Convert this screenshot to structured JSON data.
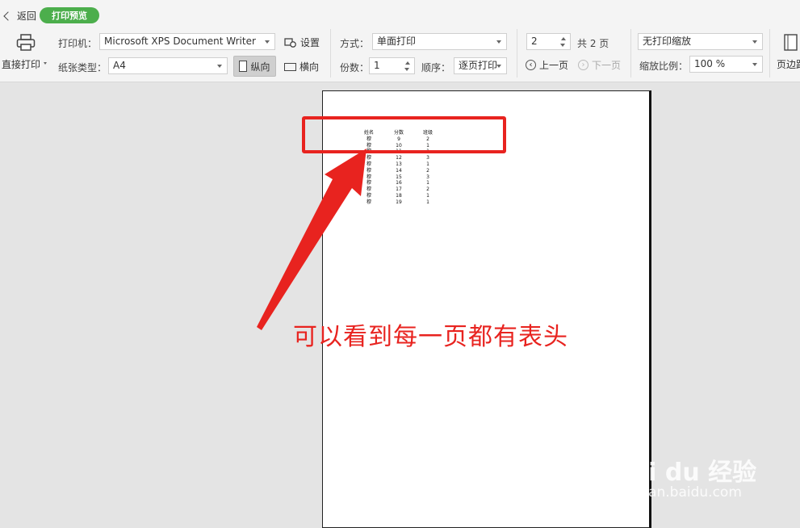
{
  "header": {
    "back_label": "返回",
    "mode_badge": "打印预览"
  },
  "toolbar": {
    "direct_print": "直接打印",
    "printer_label": "打印机：",
    "printer_value": "Microsoft XPS Document Writer",
    "settings": "设置",
    "paper_label": "纸张类型：",
    "paper_value": "A4",
    "portrait": "纵向",
    "landscape": "横向",
    "mode_label": "方式：",
    "mode_value": "单面打印",
    "copies_label": "份数：",
    "copies_value": "1",
    "order_label": "顺序：",
    "order_value": "逐页打印",
    "page_value": "2",
    "total_pages": "共 2 页",
    "prev_page": "上一页",
    "next_page": "下一页",
    "scale_mode": "无打印缩放",
    "zoom_label": "缩放比例：",
    "zoom_value": "100 %",
    "margins": "页边距"
  },
  "preview_table": {
    "headers": [
      "姓名",
      "分数",
      "班级"
    ],
    "rows": [
      [
        "穆",
        "9",
        "2"
      ],
      [
        "穆",
        "10",
        "1"
      ],
      [
        "穆",
        "11",
        "1"
      ],
      [
        "穆",
        "12",
        "3"
      ],
      [
        "穆",
        "13",
        "1"
      ],
      [
        "穆",
        "14",
        "2"
      ],
      [
        "穆",
        "15",
        "3"
      ],
      [
        "穆",
        "16",
        "1"
      ],
      [
        "穆",
        "17",
        "2"
      ],
      [
        "穆",
        "18",
        "1"
      ],
      [
        "穆",
        "19",
        "1"
      ]
    ]
  },
  "annotation": {
    "text": "可以看到每一页都有表头",
    "color": "#e8231f"
  },
  "watermark": {
    "main": "Bai du 经验",
    "sub": "jingyan.baidu.com"
  },
  "colors": {
    "accent_green": "#4cae4c",
    "annotation_red": "#e8231f"
  }
}
